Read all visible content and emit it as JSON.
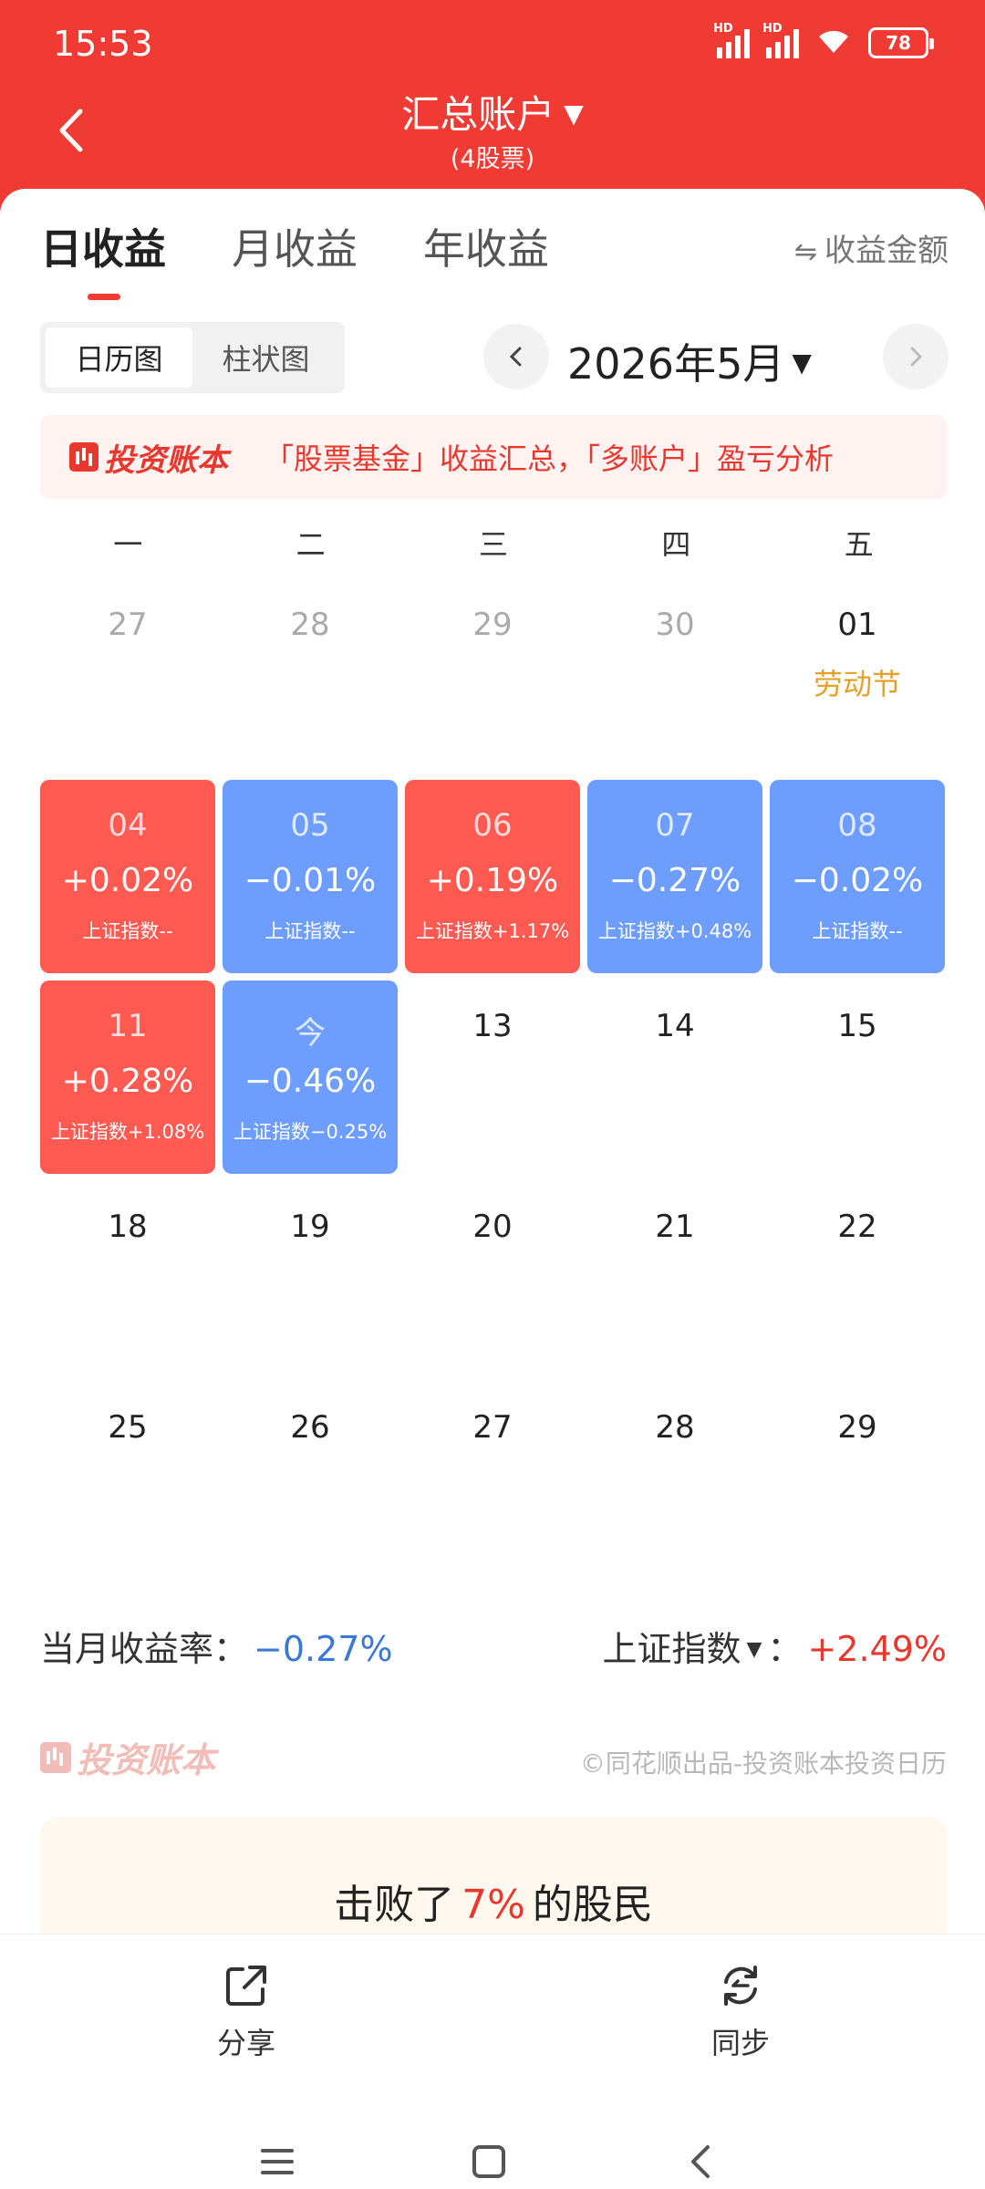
{
  "status": {
    "time": "15:53",
    "battery": "78",
    "hd1": "HD",
    "hd2": "HD"
  },
  "header": {
    "title": "汇总账户",
    "subtitle": "(4股票)"
  },
  "tabs": [
    {
      "label": "日收益"
    },
    {
      "label": "月收益"
    },
    {
      "label": "年收益"
    }
  ],
  "amount_toggle": "收益金额",
  "view": {
    "calendar": "日历图",
    "bar": "柱状图"
  },
  "month": "2026年5月",
  "banner": {
    "brand": "投资账本",
    "text": "「股票基金」收益汇总，「多账户」盈亏分析"
  },
  "weekdays": [
    "一",
    "二",
    "三",
    "四",
    "五"
  ],
  "cells": [
    {
      "day": "27",
      "state": "muted"
    },
    {
      "day": "28",
      "state": "muted"
    },
    {
      "day": "29",
      "state": "muted"
    },
    {
      "day": "30",
      "state": "muted"
    },
    {
      "day": "01",
      "state": "plain",
      "holiday": "劳动节"
    },
    {
      "day": "04",
      "state": "gain",
      "pct": "+0.02%",
      "idx": "上证指数--"
    },
    {
      "day": "05",
      "state": "loss",
      "pct": "−0.01%",
      "idx": "上证指数--"
    },
    {
      "day": "06",
      "state": "gain",
      "pct": "+0.19%",
      "idx": "上证指数+1.17%"
    },
    {
      "day": "07",
      "state": "loss",
      "pct": "−0.27%",
      "idx": "上证指数+0.48%"
    },
    {
      "day": "08",
      "state": "loss",
      "pct": "−0.02%",
      "idx": "上证指数--"
    },
    {
      "day": "11",
      "state": "gain",
      "pct": "+0.28%",
      "idx": "上证指数+1.08%"
    },
    {
      "day": "今",
      "state": "loss",
      "pct": "−0.46%",
      "idx": "上证指数−0.25%"
    },
    {
      "day": "13",
      "state": "plain"
    },
    {
      "day": "14",
      "state": "plain"
    },
    {
      "day": "15",
      "state": "plain"
    },
    {
      "day": "18",
      "state": "plain"
    },
    {
      "day": "19",
      "state": "plain"
    },
    {
      "day": "20",
      "state": "plain"
    },
    {
      "day": "21",
      "state": "plain"
    },
    {
      "day": "22",
      "state": "plain"
    },
    {
      "day": "25",
      "state": "plain"
    },
    {
      "day": "26",
      "state": "plain"
    },
    {
      "day": "27",
      "state": "plain"
    },
    {
      "day": "28",
      "state": "plain"
    },
    {
      "day": "29",
      "state": "plain"
    }
  ],
  "summary": {
    "label": "当月收益率：",
    "value": "−0.27%",
    "index_label": "上证指数",
    "index_colon": "：",
    "index_value": "+2.49%"
  },
  "footer": {
    "brand": "投资账本",
    "credit": "©同花顺出品-投资账本投资日历"
  },
  "beat": {
    "prefix": "击败了",
    "value": "7%",
    "suffix": "的股民"
  },
  "actions": {
    "share": "分享",
    "sync": "同步"
  },
  "colors": {
    "primary": "#ef3b33",
    "gain": "#ff5a52",
    "loss": "#6c9dff",
    "holiday": "#e8a02c"
  }
}
